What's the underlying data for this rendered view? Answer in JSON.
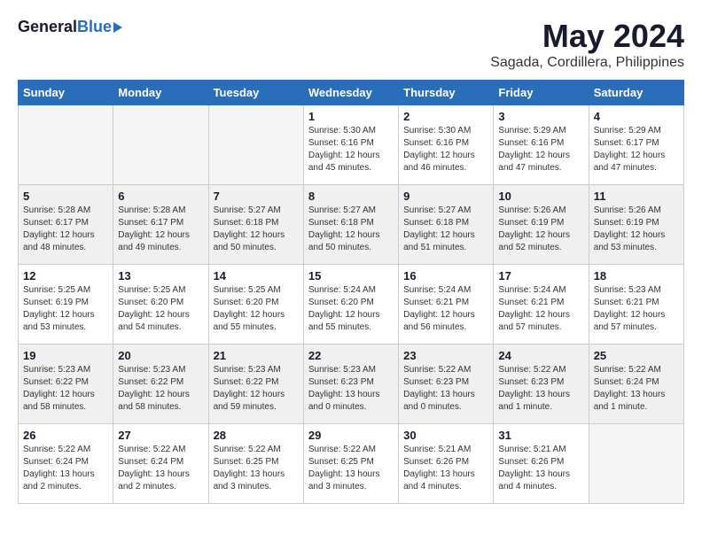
{
  "logo": {
    "general": "General",
    "blue": "Blue"
  },
  "title": "May 2024",
  "location": "Sagada, Cordillera, Philippines",
  "days_of_week": [
    "Sunday",
    "Monday",
    "Tuesday",
    "Wednesday",
    "Thursday",
    "Friday",
    "Saturday"
  ],
  "weeks": [
    [
      {
        "day": "",
        "empty": true
      },
      {
        "day": "",
        "empty": true
      },
      {
        "day": "",
        "empty": true
      },
      {
        "day": "1",
        "sunrise": "5:30 AM",
        "sunset": "6:16 PM",
        "daylight": "12 hours and 45 minutes."
      },
      {
        "day": "2",
        "sunrise": "5:30 AM",
        "sunset": "6:16 PM",
        "daylight": "12 hours and 46 minutes."
      },
      {
        "day": "3",
        "sunrise": "5:29 AM",
        "sunset": "6:16 PM",
        "daylight": "12 hours and 47 minutes."
      },
      {
        "day": "4",
        "sunrise": "5:29 AM",
        "sunset": "6:17 PM",
        "daylight": "12 hours and 47 minutes."
      }
    ],
    [
      {
        "day": "5",
        "sunrise": "5:28 AM",
        "sunset": "6:17 PM",
        "daylight": "12 hours and 48 minutes."
      },
      {
        "day": "6",
        "sunrise": "5:28 AM",
        "sunset": "6:17 PM",
        "daylight": "12 hours and 49 minutes."
      },
      {
        "day": "7",
        "sunrise": "5:27 AM",
        "sunset": "6:18 PM",
        "daylight": "12 hours and 50 minutes."
      },
      {
        "day": "8",
        "sunrise": "5:27 AM",
        "sunset": "6:18 PM",
        "daylight": "12 hours and 50 minutes."
      },
      {
        "day": "9",
        "sunrise": "5:27 AM",
        "sunset": "6:18 PM",
        "daylight": "12 hours and 51 minutes."
      },
      {
        "day": "10",
        "sunrise": "5:26 AM",
        "sunset": "6:19 PM",
        "daylight": "12 hours and 52 minutes."
      },
      {
        "day": "11",
        "sunrise": "5:26 AM",
        "sunset": "6:19 PM",
        "daylight": "12 hours and 53 minutes."
      }
    ],
    [
      {
        "day": "12",
        "sunrise": "5:25 AM",
        "sunset": "6:19 PM",
        "daylight": "12 hours and 53 minutes."
      },
      {
        "day": "13",
        "sunrise": "5:25 AM",
        "sunset": "6:20 PM",
        "daylight": "12 hours and 54 minutes."
      },
      {
        "day": "14",
        "sunrise": "5:25 AM",
        "sunset": "6:20 PM",
        "daylight": "12 hours and 55 minutes."
      },
      {
        "day": "15",
        "sunrise": "5:24 AM",
        "sunset": "6:20 PM",
        "daylight": "12 hours and 55 minutes."
      },
      {
        "day": "16",
        "sunrise": "5:24 AM",
        "sunset": "6:21 PM",
        "daylight": "12 hours and 56 minutes."
      },
      {
        "day": "17",
        "sunrise": "5:24 AM",
        "sunset": "6:21 PM",
        "daylight": "12 hours and 57 minutes."
      },
      {
        "day": "18",
        "sunrise": "5:23 AM",
        "sunset": "6:21 PM",
        "daylight": "12 hours and 57 minutes."
      }
    ],
    [
      {
        "day": "19",
        "sunrise": "5:23 AM",
        "sunset": "6:22 PM",
        "daylight": "12 hours and 58 minutes."
      },
      {
        "day": "20",
        "sunrise": "5:23 AM",
        "sunset": "6:22 PM",
        "daylight": "12 hours and 58 minutes."
      },
      {
        "day": "21",
        "sunrise": "5:23 AM",
        "sunset": "6:22 PM",
        "daylight": "12 hours and 59 minutes."
      },
      {
        "day": "22",
        "sunrise": "5:23 AM",
        "sunset": "6:23 PM",
        "daylight": "13 hours and 0 minutes."
      },
      {
        "day": "23",
        "sunrise": "5:22 AM",
        "sunset": "6:23 PM",
        "daylight": "13 hours and 0 minutes."
      },
      {
        "day": "24",
        "sunrise": "5:22 AM",
        "sunset": "6:23 PM",
        "daylight": "13 hours and 1 minute."
      },
      {
        "day": "25",
        "sunrise": "5:22 AM",
        "sunset": "6:24 PM",
        "daylight": "13 hours and 1 minute."
      }
    ],
    [
      {
        "day": "26",
        "sunrise": "5:22 AM",
        "sunset": "6:24 PM",
        "daylight": "13 hours and 2 minutes."
      },
      {
        "day": "27",
        "sunrise": "5:22 AM",
        "sunset": "6:24 PM",
        "daylight": "13 hours and 2 minutes."
      },
      {
        "day": "28",
        "sunrise": "5:22 AM",
        "sunset": "6:25 PM",
        "daylight": "13 hours and 3 minutes."
      },
      {
        "day": "29",
        "sunrise": "5:22 AM",
        "sunset": "6:25 PM",
        "daylight": "13 hours and 3 minutes."
      },
      {
        "day": "30",
        "sunrise": "5:21 AM",
        "sunset": "6:26 PM",
        "daylight": "13 hours and 4 minutes."
      },
      {
        "day": "31",
        "sunrise": "5:21 AM",
        "sunset": "6:26 PM",
        "daylight": "13 hours and 4 minutes."
      },
      {
        "day": "",
        "empty": true
      }
    ]
  ]
}
